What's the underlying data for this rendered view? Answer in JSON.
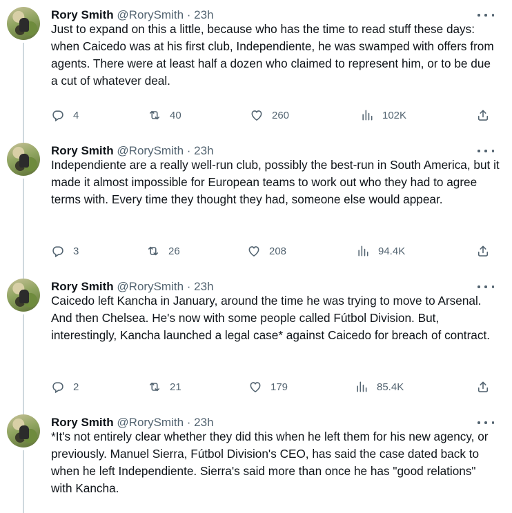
{
  "tweets": [
    {
      "name": "Rory Smith",
      "handle": "@RorySmith",
      "dot": "·",
      "time": "23h",
      "text": "Just to expand on this a little, because who has the time to read stuff these days: when Caicedo was at his first club, Independiente, he was swamped with offers from agents. There were at least half a dozen who claimed to represent him, or to be due a cut of whatever deal.",
      "replies": "4",
      "retweets": "40",
      "likes": "260",
      "views": "102K"
    },
    {
      "name": "Rory Smith",
      "handle": "@RorySmith",
      "dot": "·",
      "time": "23h",
      "text": "Independiente are a really well-run club, possibly the best-run in South America, but it made it almost impossible for European teams to work out who they had to agree terms with. Every time they thought they had, someone else would appear.",
      "replies": "3",
      "retweets": "26",
      "likes": "208",
      "views": "94.4K"
    },
    {
      "name": "Rory Smith",
      "handle": "@RorySmith",
      "dot": "·",
      "time": "23h",
      "text": "Caicedo left Kancha in January, around the time he was trying to move to Arsenal. And then Chelsea. He's now with some people called Fútbol Division. But, interestingly, Kancha launched a legal case* against Caicedo for breach of contract.",
      "replies": "2",
      "retweets": "21",
      "likes": "179",
      "views": "85.4K"
    },
    {
      "name": "Rory Smith",
      "handle": "@RorySmith",
      "dot": "·",
      "time": "23h",
      "text": "*It's not entirely clear whether they did this when he left them for his new agency, or previously. Manuel Sierra, Fútbol Division's CEO, has said the case dated back to when he left Independiente. Sierra's said more than once he has \"good relations\" with Kancha."
    }
  ],
  "icons": {
    "reply": "reply-icon",
    "retweet": "retweet-icon",
    "like": "heart-icon",
    "views": "views-icon",
    "share": "share-icon",
    "more": "more-icon"
  },
  "colors": {
    "text": "#0f1419",
    "secondary": "#536471",
    "thread_line": "#cfd9de"
  }
}
